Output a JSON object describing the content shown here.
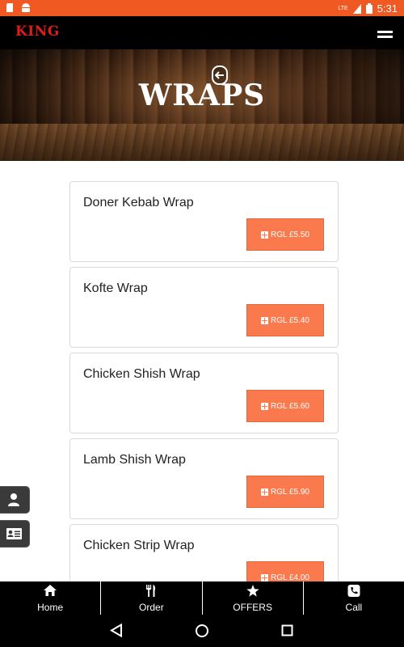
{
  "status_bar": {
    "time": "5:31",
    "left_icons": [
      "sd-card-icon",
      "android-icon"
    ],
    "right_icons": [
      "lte-signal-icon",
      "battery-icon"
    ],
    "network": "LTE"
  },
  "app_bar": {
    "logo_text": "KING",
    "menu_icon": "hamburger-icon"
  },
  "hero": {
    "title": "WRAPS",
    "back_icon": "back-arrow-icon"
  },
  "items": [
    {
      "name": "Doner Kebab Wrap",
      "price": "RGL £5.50"
    },
    {
      "name": "Kofte Wrap",
      "price": "RGL £5.40"
    },
    {
      "name": "Chicken Shish Wrap",
      "price": "RGL £5.60"
    },
    {
      "name": "Lamb Shish Wrap",
      "price": "RGL £5.90"
    },
    {
      "name": "Chicken Strip Wrap",
      "price": "RGL £4.00"
    }
  ],
  "side_buttons": [
    "user-icon",
    "contact-card-icon"
  ],
  "bottom_nav": [
    {
      "label": "Home",
      "icon": "home-icon"
    },
    {
      "label": "Order",
      "icon": "cutlery-icon"
    },
    {
      "label": "OFFERS",
      "icon": "star-icon"
    },
    {
      "label": "Call",
      "icon": "phone-icon"
    }
  ],
  "system_nav": [
    "back-triangle-icon",
    "home-circle-icon",
    "recents-square-icon"
  ],
  "colors": {
    "status_bar": "#f05a22",
    "price_button": "#fb7a4d",
    "logo": "#e11a1a",
    "app_bar": "#000000"
  }
}
